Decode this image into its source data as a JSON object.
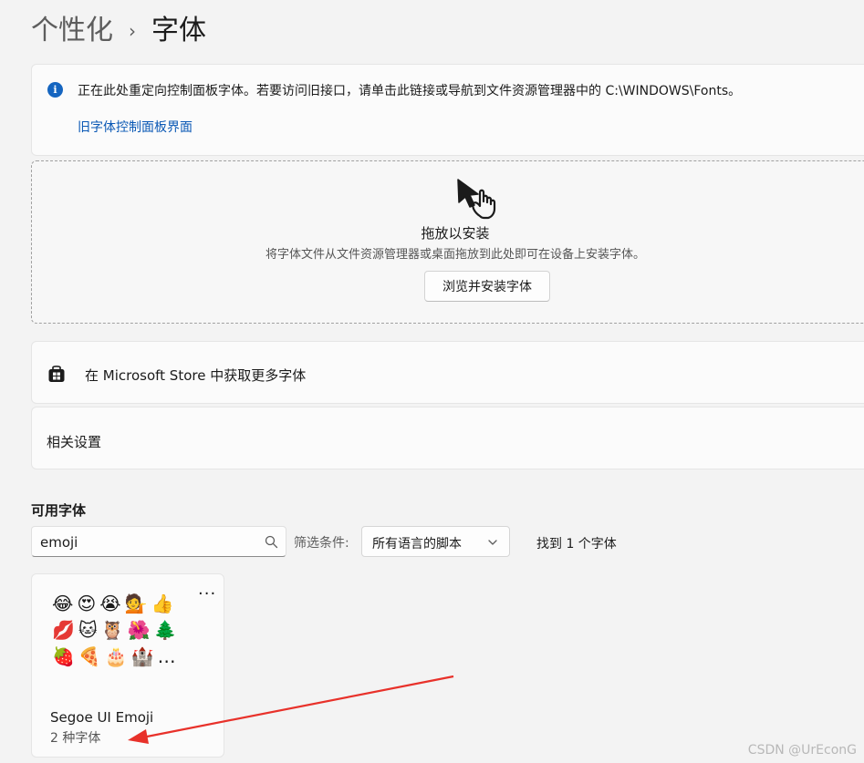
{
  "breadcrumb": {
    "parent": "个性化",
    "separator": "›",
    "current": "字体"
  },
  "info_banner": {
    "icon": "info-icon",
    "message": "正在此处重定向控制面板字体。若要访问旧接口，请单击此链接或导航到文件资源管理器中的 C:\\WINDOWS\\Fonts。",
    "link_label": "旧字体控制面板界面"
  },
  "drop_zone": {
    "icon": "drag-hand-icon",
    "title": "拖放以安装",
    "subtitle": "将字体文件从文件资源管理器或桌面拖放到此处即可在设备上安装字体。",
    "browse_button": "浏览并安装字体"
  },
  "store_link": {
    "icon": "store-icon",
    "label": "在 Microsoft Store 中获取更多字体"
  },
  "related": {
    "label": "相关设置"
  },
  "available_fonts": {
    "section_title": "可用字体",
    "search_value": "emoji",
    "filter_label": "筛选条件:",
    "filter_value": "所有语言的脚本",
    "result_count": "找到 1 个字体"
  },
  "font_tile": {
    "preview_rows": [
      "😂😍😭💁👍",
      "💋🐱🦉🌺🌲",
      "🍓🍕🎂🏰…"
    ],
    "name": "Segoe UI Emoji",
    "count": "2 种字体"
  },
  "watermark": "CSDN @UrEconG",
  "colors": {
    "background": "#f3f3f3",
    "card": "#fbfbfb",
    "link": "#0a58b5",
    "info_icon": "#1565c0",
    "arrow": "#e8312a"
  }
}
